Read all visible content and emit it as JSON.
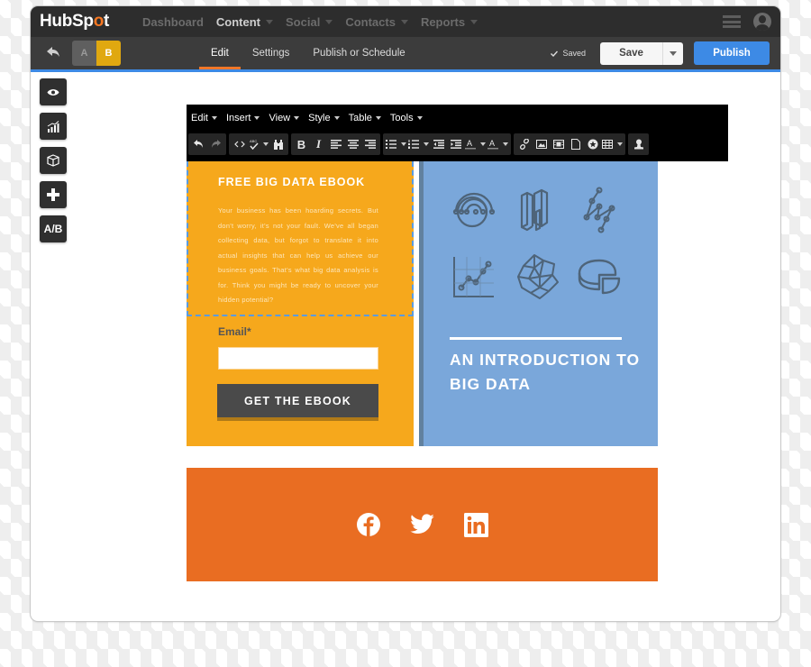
{
  "app": {
    "brand": "HubSpot",
    "brand_color": "#f57722",
    "accent_color": "#3d8ae5"
  },
  "topnav": {
    "items": [
      {
        "label": "Dashboard",
        "has_dropdown": false,
        "active": false
      },
      {
        "label": "Content",
        "has_dropdown": true,
        "active": true
      },
      {
        "label": "Social",
        "has_dropdown": true,
        "active": false
      },
      {
        "label": "Contacts",
        "has_dropdown": true,
        "active": false
      },
      {
        "label": "Reports",
        "has_dropdown": true,
        "active": false
      }
    ],
    "menu_icon": "hamburger-icon",
    "profile_icon": "user-avatar-icon"
  },
  "subnav": {
    "back_icon": "reply-arrow-icon",
    "ab_variants": [
      "A",
      "B"
    ],
    "ab_selected": "B",
    "tabs": [
      {
        "label": "Edit",
        "active": true
      },
      {
        "label": "Settings",
        "active": false
      },
      {
        "label": "Publish or Schedule",
        "active": false
      }
    ],
    "saved_status": "Saved",
    "save_label": "Save",
    "publish_label": "Publish"
  },
  "side_tools": [
    {
      "name": "preview",
      "icon": "eye-icon"
    },
    {
      "name": "analytics",
      "icon": "bar-chart-icon"
    },
    {
      "name": "modules",
      "icon": "cube-icon"
    },
    {
      "name": "add",
      "icon": "plus-icon"
    },
    {
      "name": "ab-test",
      "label": "A/B"
    }
  ],
  "editor": {
    "menus": [
      "Edit",
      "Insert",
      "View",
      "Style",
      "Table",
      "Tools"
    ],
    "toolbar_icons": [
      "undo-icon",
      "redo-icon",
      "source-code-icon",
      "spellcheck-icon",
      "find-replace-icon",
      "bold-icon",
      "italic-icon",
      "align-left-icon",
      "align-center-icon",
      "align-right-icon",
      "bullet-list-icon",
      "numbered-list-icon",
      "outdent-icon",
      "indent-icon",
      "text-color-icon",
      "background-color-icon",
      "link-icon",
      "image-icon",
      "video-icon",
      "page-icon",
      "cta-icon",
      "table-icon",
      "personalize-icon"
    ]
  },
  "page": {
    "left": {
      "title": "FREE BIG DATA EBOOK",
      "body": "Your business has been hoarding secrets. But don't worry, it's not your fault. We've all began collecting data, but forgot to translate it into actual insights that can help us achieve our business goals. That's what big data analysis is for. Think you might be ready to uncover your hidden potential?",
      "email_label": "Email*",
      "email_value": "",
      "cta_label": "GET THE EBOOK",
      "bg_color": "#f6a81c"
    },
    "right": {
      "cover_title": "AN INTRODUCTION TO BIG DATA",
      "icons": [
        "arc-network-icon",
        "bars-3d-icon",
        "node-graph-icon",
        "line-plot-icon",
        "mesh-map-icon",
        "pie-chart-icon"
      ],
      "bg_color": "#7aa7da"
    },
    "footer": {
      "social": [
        "facebook-icon",
        "twitter-icon",
        "linkedin-icon"
      ],
      "bg_color": "#e96d22"
    }
  }
}
